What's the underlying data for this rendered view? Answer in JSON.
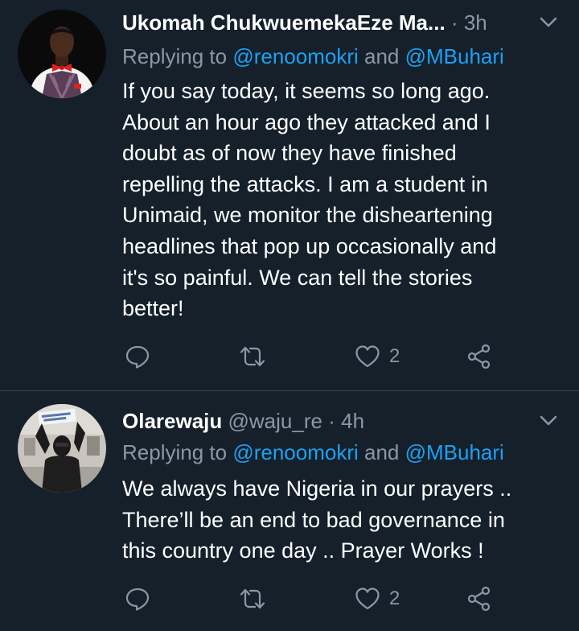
{
  "colors": {
    "background": "#15202b",
    "text_primary": "#ffffff",
    "text_secondary": "#8899a6",
    "accent": "#1da1f2",
    "divider": "#38444d"
  },
  "tweets": [
    {
      "display_name": "Ukomah ChukwuemekaEze Ma...",
      "handle": "",
      "separator": "·",
      "time": "3h",
      "replying_prefix": "Replying to ",
      "mention_1": "@renoomokri",
      "replying_joiner": " and ",
      "mention_2": "@MBuhari",
      "text_lines": [
        "If you say today, it seems so long ago.",
        "About an hour ago they attacked and I",
        "doubt as of now they have finished",
        "repelling the attacks. I am a student in",
        "Unimaid, we monitor the disheartening",
        "headlines that pop up occasionally and",
        "it's so painful. We can tell the stories",
        "better!"
      ],
      "like_count": "2",
      "icons": [
        "reply-icon",
        "retweet-icon",
        "like-icon",
        "share-icon",
        "chevron-down-icon"
      ]
    },
    {
      "display_name": "Olarewaju",
      "handle": "@waju_re",
      "separator": "·",
      "time": "4h",
      "replying_prefix": "Replying to ",
      "mention_1": "@renoomokri",
      "replying_joiner": " and ",
      "mention_2": "@MBuhari",
      "text_lines": [
        "We always have Nigeria in our prayers ..",
        "There’ll be an end to bad governance in",
        "this country one day .. Prayer Works !"
      ],
      "like_count": "2",
      "icons": [
        "reply-icon",
        "retweet-icon",
        "like-icon",
        "share-icon",
        "chevron-down-icon"
      ]
    }
  ]
}
